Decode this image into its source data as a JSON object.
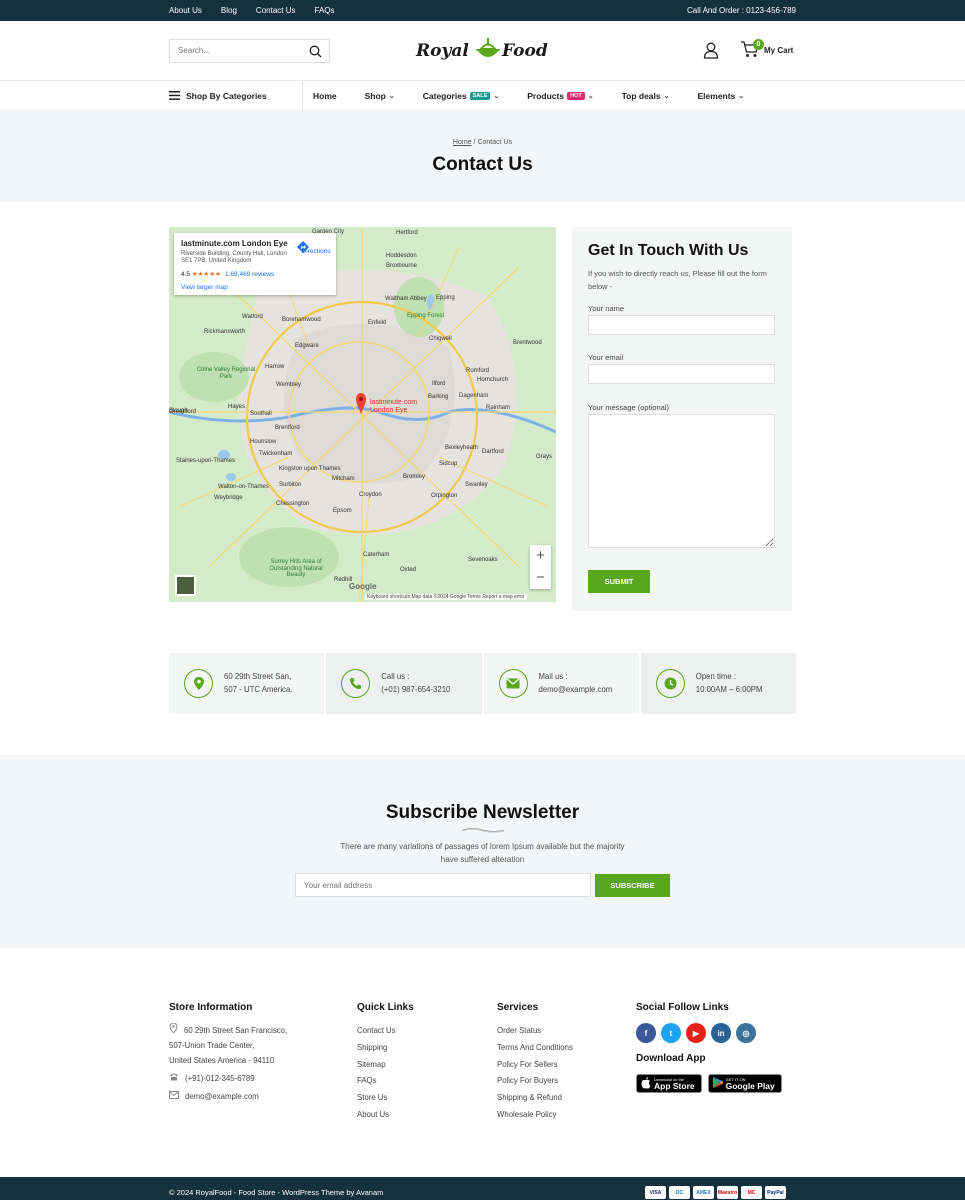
{
  "topbar": {
    "links": [
      "About Us",
      "Blog",
      "Contact Us",
      "FAQs"
    ],
    "order": "Call And Order : 0123-456-789"
  },
  "header": {
    "search_placeholder": "Search...",
    "logo_left": "Royal",
    "logo_right": "Food",
    "cart_count": "0",
    "cart_label": "My Cart"
  },
  "nav": {
    "categories_label": "Shop By Categories",
    "items": [
      {
        "label": "Home",
        "badge": "",
        "caret": false
      },
      {
        "label": "Shop",
        "badge": "",
        "caret": true
      },
      {
        "label": "Categories",
        "badge": "SALE",
        "badge_color": "#1a9c8c",
        "caret": true
      },
      {
        "label": "Products",
        "badge": "HOT",
        "badge_color": "#e52d6f",
        "caret": true
      },
      {
        "label": "Top deals",
        "badge": "",
        "caret": true
      },
      {
        "label": "Elements",
        "badge": "",
        "caret": true
      }
    ]
  },
  "hero": {
    "crumb_home": "Home",
    "crumb_sep": " / ",
    "crumb_current": "Contact Us",
    "title": "Contact Us"
  },
  "map": {
    "place": "lastminute.com London Eye",
    "address": "Riverside Building, County Hall, London SE1 7PB, United Kingdom",
    "rating": "4.5",
    "stars": "★★★★★",
    "reviews": "1,69,469 reviews",
    "larger": "View larger map",
    "directions": "Directions",
    "pin_label_1": "lastminute.com",
    "pin_label_2": "London Eye",
    "attribution": "Keyboard shortcuts    Map data ©2024 Google    Terms    Report a map error",
    "google": "Google",
    "towns": [
      "Garden City",
      "Hertford",
      "Hoddesdon",
      "Broxbourne",
      "Waltham Abbey",
      "Epping",
      "Epping Forest",
      "Watford",
      "Borehamwood",
      "Enfield",
      "Chigwell",
      "Brentwood",
      "Rickmansworth",
      "Edgware",
      "Colne Valley Regional Park",
      "Harrow",
      "Wembley",
      "Ilford",
      "Romford",
      "Hornchurch",
      "Barking",
      "Dagenham",
      "Rainham",
      "Greenford",
      "Hayes",
      "Southall",
      "Slough",
      "Hounslow",
      "Brentford",
      "Twickenham",
      "Bexleyheath",
      "Dartford",
      "Sidcup",
      "Grays",
      "Staines-upon-Thames",
      "Kingston upon Thames",
      "Surbiton",
      "Walton-on-Thames",
      "Weybridge",
      "Mitcham",
      "Bromley",
      "Croydon",
      "Orpington",
      "Swanley",
      "Chessington",
      "Epsom",
      "Caterham",
      "Sevenoaks",
      "Surrey Hills Area of Outstanding Natural Beauty",
      "Redhill",
      "Oxted"
    ]
  },
  "form": {
    "title": "Get In Touch With Us",
    "subtitle": "If you wish to directly reach us, Please fill out the form below -",
    "name_label": "Your name",
    "email_label": "Your email",
    "message_label": "Your message (optional)",
    "submit": "SUBMIT"
  },
  "info": [
    {
      "icon": "location-icon",
      "line1": "60 29th Street San,",
      "line2": "507 - UTC America."
    },
    {
      "icon": "phone-icon",
      "line1": "Call us :",
      "line2": "(+01) 987-654-3210"
    },
    {
      "icon": "mail-icon",
      "line1": "Mail us :",
      "line2": "demo@example.com"
    },
    {
      "icon": "clock-icon",
      "line1": "Open time :",
      "line2": "10:00AM – 6:00PM"
    }
  ],
  "newsletter": {
    "title": "Subscribe Newsletter",
    "text": "There are many variations of passages of lorem Ipsum available but the majority have suffered alteration",
    "placeholder": "Your email address",
    "button": "SUBSCRIBE"
  },
  "footer": {
    "store_title": "Store Information",
    "address_1": "60 29th Street San Francisco,",
    "address_2": "507-Union Trade Center,",
    "address_3": "United States America - 94110",
    "phone": "(+91)-012-345-6789",
    "email": "demo@example.com",
    "quick_title": "Quick Links",
    "quick_links": [
      "Contact Us",
      "Shipping",
      "Sitemap",
      "FAQs",
      "Store Us",
      "About Us"
    ],
    "services_title": "Services",
    "services": [
      "Order Status",
      "Terms And Conditions",
      "Policy For Sellers",
      "Policy For Buyers",
      "Shipping & Refund",
      "Wholesale Policy"
    ],
    "social_title": "Social Follow Links",
    "social": [
      {
        "name": "facebook-icon",
        "glyph": "f",
        "color": "#3b5998"
      },
      {
        "name": "twitter-icon",
        "glyph": "t",
        "color": "#1da1f2"
      },
      {
        "name": "youtube-icon",
        "glyph": "▶",
        "color": "#e62117"
      },
      {
        "name": "linkedin-icon",
        "glyph": "in",
        "color": "#2b6398"
      },
      {
        "name": "instagram-icon",
        "glyph": "◎",
        "color": "#3f729b"
      }
    ],
    "app_title": "Download App",
    "appstore_small": "Download on the",
    "appstore_big": "App Store",
    "gplay_small": "GET IT ON",
    "gplay_big": "Google Play",
    "copyright": "© 2024 RoyalFood - Food Store - WordPress Theme by Avanam",
    "cards": [
      {
        "label": "VISA",
        "color": "#1a1f71"
      },
      {
        "label": "DC",
        "color": "#0079be"
      },
      {
        "label": "AMEX",
        "color": "#2e77bc"
      },
      {
        "label": "Maestro",
        "color": "#cc0000"
      },
      {
        "label": "MC",
        "color": "#eb001b"
      },
      {
        "label": "PayPal",
        "color": "#003087"
      }
    ]
  },
  "colors": {
    "accent": "#5aa61c",
    "dark": "#15303f",
    "light": "#f3f5f6"
  }
}
